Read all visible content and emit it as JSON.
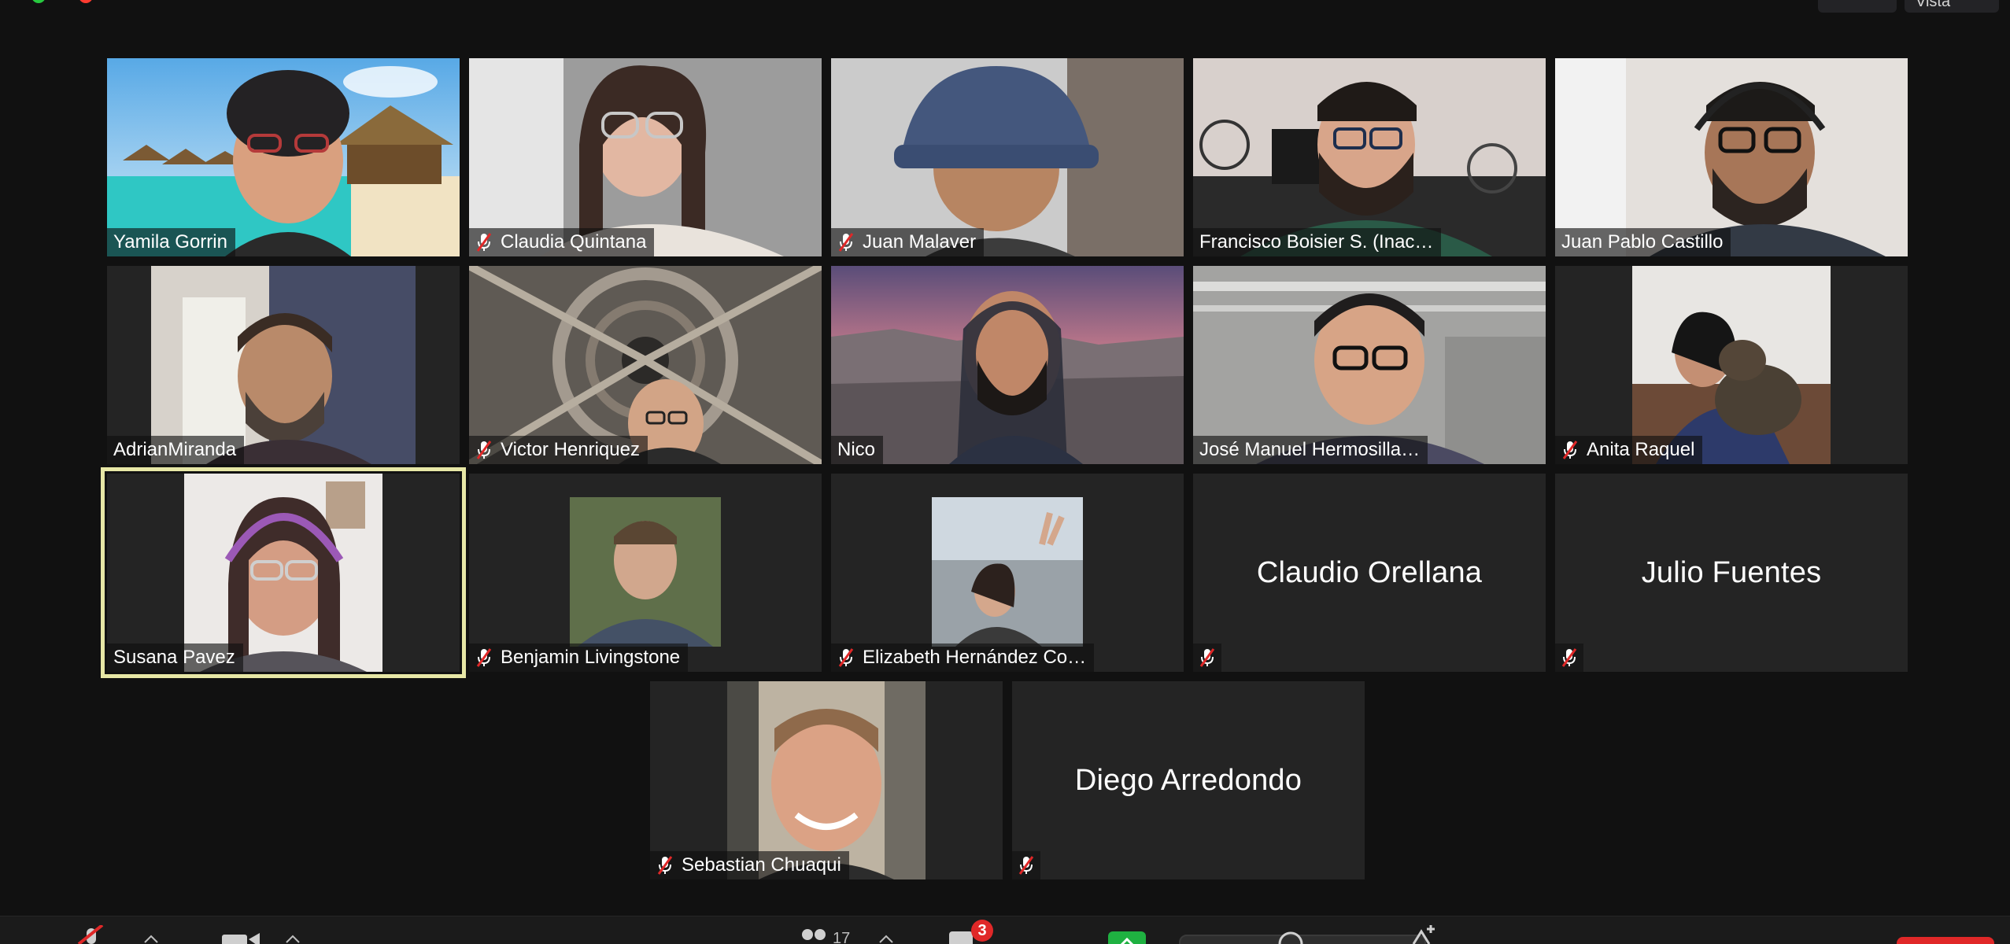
{
  "app": {
    "top_right_label": "Vista",
    "accent_active": "#e7e7a6",
    "muted_color": "#e02828"
  },
  "participants": [
    {
      "name": "Yamila Gorrin",
      "muted": false
    },
    {
      "name": "Claudia Quintana",
      "muted": true
    },
    {
      "name": "Juan Malaver",
      "muted": true
    },
    {
      "name": "Francisco Boisier S. (Inac…",
      "muted": false
    },
    {
      "name": "Juan Pablo Castillo",
      "muted": false
    },
    {
      "name": "AdrianMiranda",
      "muted": false
    },
    {
      "name": "Victor Henriquez",
      "muted": true
    },
    {
      "name": "Nico",
      "muted": false
    },
    {
      "name": "José Manuel Hermosilla…",
      "muted": false
    },
    {
      "name": "Anita Raquel",
      "muted": true
    },
    {
      "name": "Susana Pavez",
      "muted": false,
      "active_speaker": true
    },
    {
      "name": "Benjamin Livingstone",
      "muted": true
    },
    {
      "name": "Elizabeth Hernández Co…",
      "muted": true
    },
    {
      "name": "Claudio Orellana",
      "muted": true,
      "video_off": true
    },
    {
      "name": "Julio Fuentes",
      "muted": true,
      "video_off": true
    },
    {
      "name": "Sebastian Chuaqui",
      "muted": true
    },
    {
      "name": "Diego Arredondo",
      "muted": true,
      "video_off": true
    }
  ],
  "toolbar": {
    "participants_count": "17",
    "chat_badge": "3",
    "icons": [
      "mute-icon",
      "video-icon",
      "participants-icon",
      "chat-icon",
      "share-screen-icon",
      "reactions-icon",
      "apps-icon"
    ]
  }
}
